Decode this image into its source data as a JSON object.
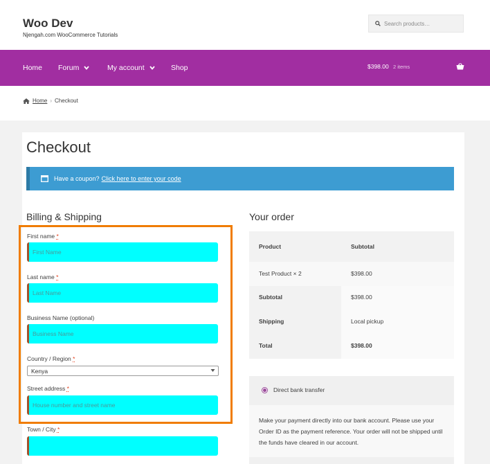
{
  "header": {
    "site_title": "Woo Dev",
    "tagline": "Njengah.com WooCommerce Tutorials",
    "search_placeholder": "Search products…"
  },
  "nav": {
    "items": [
      {
        "label": "Home"
      },
      {
        "label": "Forum"
      },
      {
        "label": "My account"
      },
      {
        "label": "Shop"
      }
    ],
    "cart_total": "$398.00",
    "cart_count": "2 items"
  },
  "breadcrumb": {
    "home": "Home",
    "separator": "›",
    "current": "Checkout"
  },
  "page": {
    "title": "Checkout"
  },
  "coupon": {
    "prompt": "Have a coupon?",
    "link": "Click here to enter your code"
  },
  "billing": {
    "heading": "Billing & Shipping",
    "required_mark": "*",
    "fields": {
      "first_name": {
        "label": "First name",
        "placeholder": "First Name"
      },
      "last_name": {
        "label": "Last name",
        "placeholder": "Last Name"
      },
      "business": {
        "label": "Business Name (optional)",
        "placeholder": "Business Name"
      },
      "country": {
        "label": "Country / Region",
        "value": "Kenya"
      },
      "street": {
        "label": "Street address",
        "placeholder": "House number and street name"
      },
      "town": {
        "label": "Town / City",
        "placeholder": ""
      }
    }
  },
  "order": {
    "heading": "Your order",
    "col_product": "Product",
    "col_subtotal": "Subtotal",
    "item_name": "Test Product",
    "item_qty": "× 2",
    "item_total": "$398.00",
    "subtotal_label": "Subtotal",
    "subtotal_value": "$398.00",
    "shipping_label": "Shipping",
    "shipping_value": "Local pickup",
    "total_label": "Total",
    "total_value": "$398.00"
  },
  "payment": {
    "method": "Direct bank transfer",
    "description": "Make your payment directly into our bank account. Please use your Order ID as the payment reference. Your order will not be shipped until the funds have cleared in our account."
  },
  "colors": {
    "brand_purple": "#a12ea1",
    "coupon_blue": "#3d9cd2",
    "highlight_orange": "#f07c00",
    "input_cyan": "#00ffff"
  }
}
